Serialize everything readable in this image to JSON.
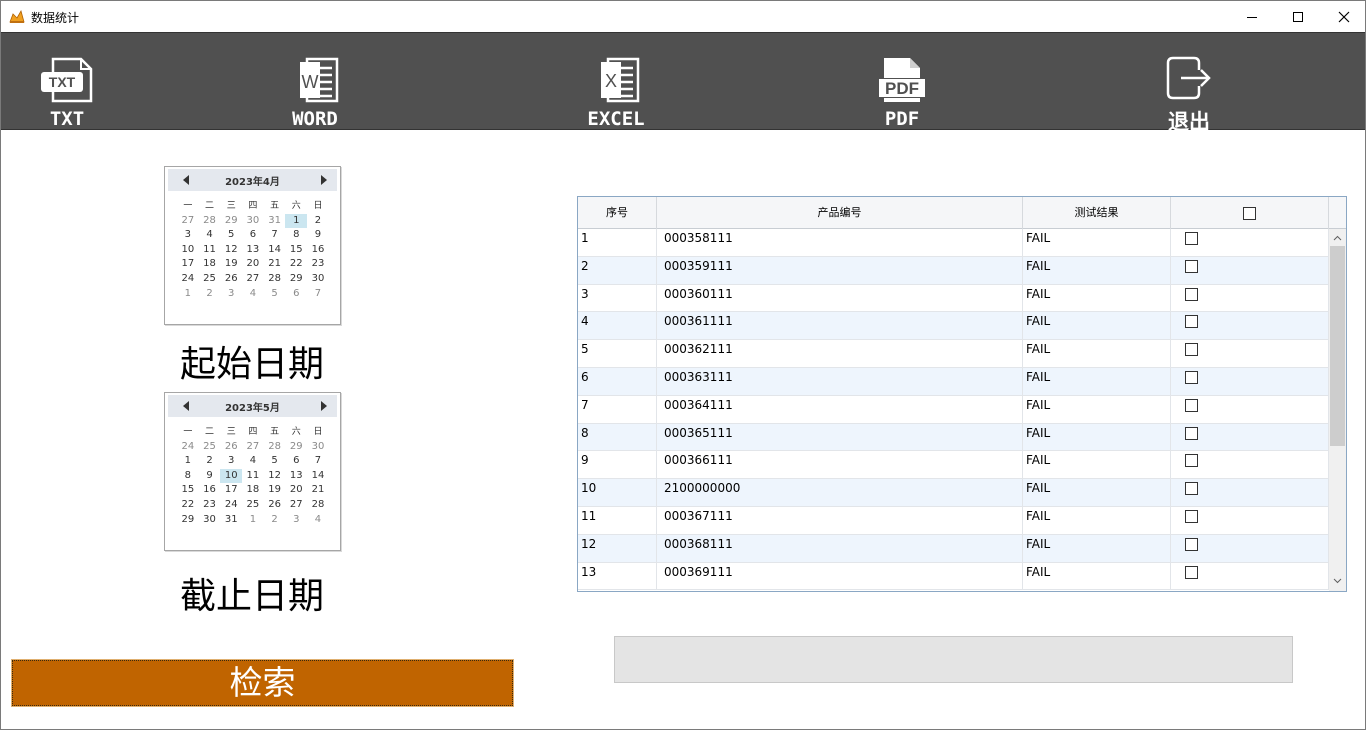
{
  "window": {
    "title": "数据统计"
  },
  "toolbar": {
    "items": [
      {
        "label": "TXT",
        "icon": "txt-file-icon",
        "badge": "TXT"
      },
      {
        "label": "WORD",
        "icon": "word-file-icon",
        "badge": "W"
      },
      {
        "label": "EXCEL",
        "icon": "excel-file-icon",
        "badge": "X"
      },
      {
        "label": "PDF",
        "icon": "pdf-file-icon",
        "badge": "PDF"
      },
      {
        "label": "退出",
        "icon": "exit-icon"
      }
    ]
  },
  "start_calendar": {
    "title": "2023年4月",
    "weekdays": [
      "一",
      "二",
      "三",
      "四",
      "五",
      "六",
      "日"
    ],
    "weeks": [
      [
        {
          "d": "27",
          "o": true
        },
        {
          "d": "28",
          "o": true
        },
        {
          "d": "29",
          "o": true
        },
        {
          "d": "30",
          "o": true
        },
        {
          "d": "31",
          "o": true
        },
        {
          "d": "1",
          "s": true
        },
        {
          "d": "2"
        }
      ],
      [
        {
          "d": "3"
        },
        {
          "d": "4"
        },
        {
          "d": "5"
        },
        {
          "d": "6"
        },
        {
          "d": "7"
        },
        {
          "d": "8"
        },
        {
          "d": "9"
        }
      ],
      [
        {
          "d": "10"
        },
        {
          "d": "11"
        },
        {
          "d": "12"
        },
        {
          "d": "13"
        },
        {
          "d": "14"
        },
        {
          "d": "15"
        },
        {
          "d": "16"
        }
      ],
      [
        {
          "d": "17"
        },
        {
          "d": "18"
        },
        {
          "d": "19"
        },
        {
          "d": "20"
        },
        {
          "d": "21"
        },
        {
          "d": "22"
        },
        {
          "d": "23"
        }
      ],
      [
        {
          "d": "24"
        },
        {
          "d": "25"
        },
        {
          "d": "26"
        },
        {
          "d": "27"
        },
        {
          "d": "28"
        },
        {
          "d": "29"
        },
        {
          "d": "30"
        }
      ],
      [
        {
          "d": "1",
          "o": true
        },
        {
          "d": "2",
          "o": true
        },
        {
          "d": "3",
          "o": true
        },
        {
          "d": "4",
          "o": true
        },
        {
          "d": "5",
          "o": true
        },
        {
          "d": "6",
          "o": true
        },
        {
          "d": "7",
          "o": true
        }
      ]
    ],
    "label": "起始日期"
  },
  "end_calendar": {
    "title": "2023年5月",
    "weekdays": [
      "一",
      "二",
      "三",
      "四",
      "五",
      "六",
      "日"
    ],
    "weeks": [
      [
        {
          "d": "24",
          "o": true
        },
        {
          "d": "25",
          "o": true
        },
        {
          "d": "26",
          "o": true
        },
        {
          "d": "27",
          "o": true
        },
        {
          "d": "28",
          "o": true
        },
        {
          "d": "29",
          "o": true
        },
        {
          "d": "30",
          "o": true
        }
      ],
      [
        {
          "d": "1"
        },
        {
          "d": "2"
        },
        {
          "d": "3"
        },
        {
          "d": "4"
        },
        {
          "d": "5"
        },
        {
          "d": "6"
        },
        {
          "d": "7"
        }
      ],
      [
        {
          "d": "8"
        },
        {
          "d": "9"
        },
        {
          "d": "10",
          "s": true
        },
        {
          "d": "11"
        },
        {
          "d": "12"
        },
        {
          "d": "13"
        },
        {
          "d": "14"
        }
      ],
      [
        {
          "d": "15"
        },
        {
          "d": "16"
        },
        {
          "d": "17"
        },
        {
          "d": "18"
        },
        {
          "d": "19"
        },
        {
          "d": "20"
        },
        {
          "d": "21"
        }
      ],
      [
        {
          "d": "22"
        },
        {
          "d": "23"
        },
        {
          "d": "24"
        },
        {
          "d": "25"
        },
        {
          "d": "26"
        },
        {
          "d": "27"
        },
        {
          "d": "28"
        }
      ],
      [
        {
          "d": "29"
        },
        {
          "d": "30"
        },
        {
          "d": "31"
        },
        {
          "d": "1",
          "o": true
        },
        {
          "d": "2",
          "o": true
        },
        {
          "d": "3",
          "o": true
        },
        {
          "d": "4",
          "o": true
        }
      ]
    ],
    "label": "截止日期"
  },
  "search": {
    "label": "检索"
  },
  "grid": {
    "headers": [
      "序号",
      "产品编号",
      "测试结果"
    ],
    "rows": [
      [
        "1",
        "000358111",
        "FAIL"
      ],
      [
        "2",
        "000359111",
        "FAIL"
      ],
      [
        "3",
        "000360111",
        "FAIL"
      ],
      [
        "4",
        "000361111",
        "FAIL"
      ],
      [
        "5",
        "000362111",
        "FAIL"
      ],
      [
        "6",
        "000363111",
        "FAIL"
      ],
      [
        "7",
        "000364111",
        "FAIL"
      ],
      [
        "8",
        "000365111",
        "FAIL"
      ],
      [
        "9",
        "000366111",
        "FAIL"
      ],
      [
        "10",
        "2100000000",
        "FAIL"
      ],
      [
        "11",
        "000367111",
        "FAIL"
      ],
      [
        "12",
        "000368111",
        "FAIL"
      ],
      [
        "13",
        "000369111",
        "FAIL"
      ]
    ]
  },
  "status": {
    "text": ""
  }
}
